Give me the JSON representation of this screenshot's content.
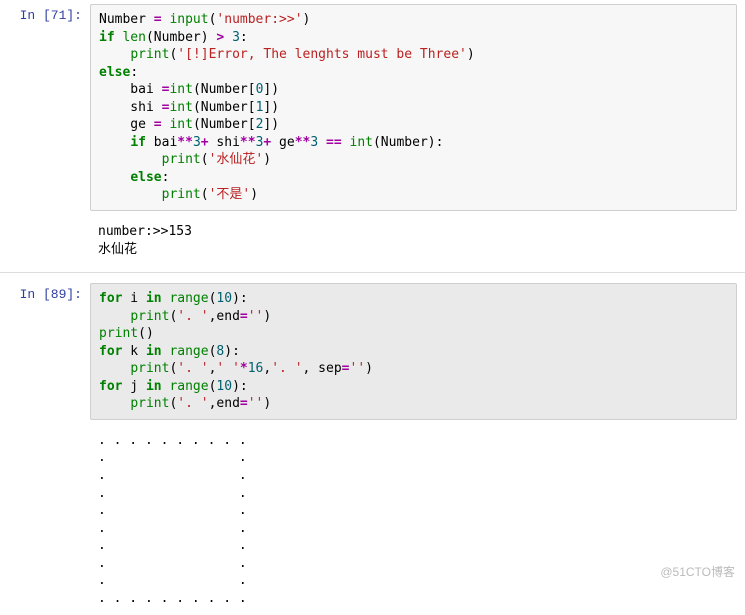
{
  "cells": [
    {
      "prompt_label": "In  [71]:",
      "code_tokens": [
        [
          [
            "name",
            "Number"
          ],
          [
            "text",
            " "
          ],
          [
            "op",
            "="
          ],
          [
            "text",
            " "
          ],
          [
            "builtin",
            "input"
          ],
          [
            "text",
            "("
          ],
          [
            "str",
            "'number:>>'"
          ],
          [
            "text",
            ")"
          ]
        ],
        [
          [
            "kw",
            "if"
          ],
          [
            "text",
            " "
          ],
          [
            "builtin",
            "len"
          ],
          [
            "text",
            "(Number) "
          ],
          [
            "op",
            ">"
          ],
          [
            "text",
            " "
          ],
          [
            "num",
            "3"
          ],
          [
            "text",
            ":"
          ]
        ],
        [
          [
            "text",
            "    "
          ],
          [
            "builtin",
            "print"
          ],
          [
            "text",
            "("
          ],
          [
            "str",
            "'[!]Error, The lenghts must be Three'"
          ],
          [
            "text",
            ")"
          ]
        ],
        [
          [
            "kw",
            "else"
          ],
          [
            "text",
            ":"
          ]
        ],
        [
          [
            "text",
            "    bai "
          ],
          [
            "op",
            "="
          ],
          [
            "builtin",
            "int"
          ],
          [
            "text",
            "(Number["
          ],
          [
            "num",
            "0"
          ],
          [
            "text",
            "])"
          ]
        ],
        [
          [
            "text",
            "    shi "
          ],
          [
            "op",
            "="
          ],
          [
            "builtin",
            "int"
          ],
          [
            "text",
            "(Number["
          ],
          [
            "num",
            "1"
          ],
          [
            "text",
            "])"
          ]
        ],
        [
          [
            "text",
            "    ge "
          ],
          [
            "op",
            "="
          ],
          [
            "text",
            " "
          ],
          [
            "builtin",
            "int"
          ],
          [
            "text",
            "(Number["
          ],
          [
            "num",
            "2"
          ],
          [
            "text",
            "])"
          ]
        ],
        [
          [
            "text",
            "    "
          ],
          [
            "kw",
            "if"
          ],
          [
            "text",
            " bai"
          ],
          [
            "op",
            "**"
          ],
          [
            "num",
            "3"
          ],
          [
            "op",
            "+"
          ],
          [
            "text",
            " shi"
          ],
          [
            "op",
            "**"
          ],
          [
            "num",
            "3"
          ],
          [
            "op",
            "+"
          ],
          [
            "text",
            " ge"
          ],
          [
            "op",
            "**"
          ],
          [
            "num",
            "3"
          ],
          [
            "text",
            " "
          ],
          [
            "op",
            "=="
          ],
          [
            "text",
            " "
          ],
          [
            "builtin",
            "int"
          ],
          [
            "text",
            "(Number):"
          ]
        ],
        [
          [
            "text",
            "        "
          ],
          [
            "builtin",
            "print"
          ],
          [
            "text",
            "("
          ],
          [
            "str",
            "'水仙花'"
          ],
          [
            "text",
            ")"
          ]
        ],
        [
          [
            "text",
            "    "
          ],
          [
            "kw",
            "else"
          ],
          [
            "text",
            ":"
          ]
        ],
        [
          [
            "text",
            "        "
          ],
          [
            "builtin",
            "print"
          ],
          [
            "text",
            "("
          ],
          [
            "str",
            "'不是'"
          ],
          [
            "text",
            ")"
          ]
        ]
      ],
      "output": "number:>>153\n水仙花"
    },
    {
      "prompt_label": "In  [89]:",
      "selected": true,
      "code_tokens": [
        [
          [
            "kw",
            "for"
          ],
          [
            "text",
            " i "
          ],
          [
            "kw",
            "in"
          ],
          [
            "text",
            " "
          ],
          [
            "builtin",
            "range"
          ],
          [
            "text",
            "("
          ],
          [
            "num",
            "10"
          ],
          [
            "text",
            "):"
          ]
        ],
        [
          [
            "text",
            "    "
          ],
          [
            "builtin",
            "print"
          ],
          [
            "text",
            "("
          ],
          [
            "str",
            "'. '"
          ],
          [
            "text",
            ",end"
          ],
          [
            "op",
            "="
          ],
          [
            "str",
            "''"
          ],
          [
            "text",
            ")"
          ]
        ],
        [
          [
            "builtin",
            "print"
          ],
          [
            "text",
            "()"
          ]
        ],
        [
          [
            "kw",
            "for"
          ],
          [
            "text",
            " k "
          ],
          [
            "kw",
            "in"
          ],
          [
            "text",
            " "
          ],
          [
            "builtin",
            "range"
          ],
          [
            "text",
            "("
          ],
          [
            "num",
            "8"
          ],
          [
            "text",
            "):"
          ]
        ],
        [
          [
            "text",
            "    "
          ],
          [
            "builtin",
            "print"
          ],
          [
            "text",
            "("
          ],
          [
            "str",
            "'. '"
          ],
          [
            "text",
            ","
          ],
          [
            "str",
            "' '"
          ],
          [
            "op",
            "*"
          ],
          [
            "num",
            "16"
          ],
          [
            "text",
            ","
          ],
          [
            "str",
            "'. '"
          ],
          [
            "text",
            ", sep"
          ],
          [
            "op",
            "="
          ],
          [
            "str",
            "''"
          ],
          [
            "text",
            ")"
          ]
        ],
        [
          [
            "kw",
            "for"
          ],
          [
            "text",
            " j "
          ],
          [
            "kw",
            "in"
          ],
          [
            "text",
            " "
          ],
          [
            "builtin",
            "range"
          ],
          [
            "text",
            "("
          ],
          [
            "num",
            "10"
          ],
          [
            "text",
            "):"
          ]
        ],
        [
          [
            "text",
            "    "
          ],
          [
            "builtin",
            "print"
          ],
          [
            "text",
            "("
          ],
          [
            "str",
            "'. '"
          ],
          [
            "text",
            ",end"
          ],
          [
            "op",
            "="
          ],
          [
            "str",
            "''"
          ],
          [
            "text",
            ")"
          ]
        ]
      ],
      "output": ". . . . . . . . . . \n.                 . \n.                 . \n.                 . \n.                 . \n.                 . \n.                 . \n.                 . \n.                 . \n. . . . . . . . . . "
    }
  ],
  "watermark": "@51CTO博客"
}
